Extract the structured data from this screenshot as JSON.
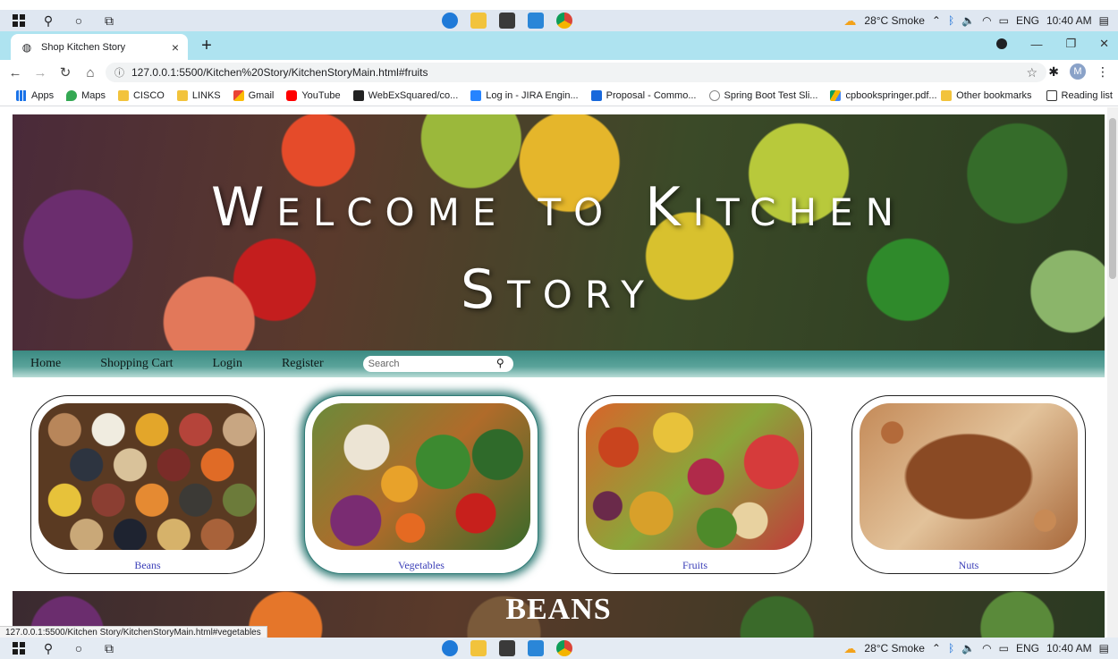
{
  "taskbar": {
    "weather": "28°C  Smoke",
    "language": "ENG",
    "time": "10:40 AM"
  },
  "browser": {
    "tab_title": "Shop Kitchen Story",
    "url": "127.0.0.1:5500/Kitchen%20Story/KitchenStoryMain.html#fruits",
    "profile_initial": "M",
    "bookmarks": [
      "Apps",
      "Maps",
      "CISCO",
      "LINKS",
      "Gmail",
      "YouTube",
      "WebExSquared/co...",
      "Log in - JIRA Engin...",
      "Proposal - Commo...",
      "Spring Boot Test Sli...",
      "cpbookspringer.pdf..."
    ],
    "bookmarks_right": [
      "Other bookmarks",
      "Reading list"
    ],
    "status_url": "127.0.0.1:5500/Kitchen Story/KitchenStoryMain.html#vegetables"
  },
  "hero": {
    "title_line1": "Welcome to Kitchen",
    "title_line2": "Story"
  },
  "nav": {
    "links": [
      "Home",
      "Shopping Cart",
      "Login",
      "Register"
    ],
    "search_placeholder": "Search"
  },
  "categories": [
    {
      "label": "Beans"
    },
    {
      "label": "Vegetables"
    },
    {
      "label": "Fruits"
    },
    {
      "label": "Nuts"
    }
  ],
  "section": {
    "title": "BEANS"
  },
  "colors": {
    "navbar_teal": "#3b8a82",
    "card_label": "#3b3fb8",
    "tabstrip": "#aee3f0"
  }
}
